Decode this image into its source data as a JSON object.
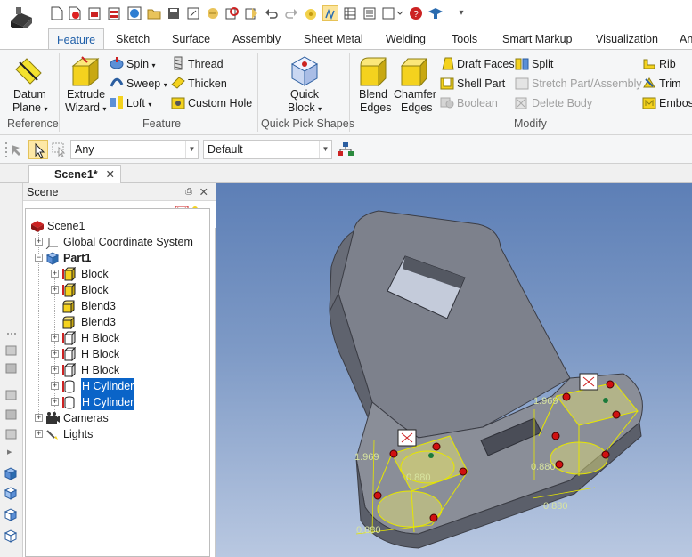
{
  "app": {
    "title": "IronCAD"
  },
  "quick_access": {
    "icons": [
      "new-icon",
      "new-template-icon",
      "open-red-icon",
      "print-icon",
      "globe-icon",
      "open-folder-icon",
      "save-icon",
      "save-as-icon",
      "publish-icon",
      "zoom-icon",
      "import-icon",
      "undo-icon",
      "redo-icon",
      "smart-icon",
      "catalog-icon",
      "table-icon",
      "list-icon",
      "help-icon",
      "graduate-icon",
      "customize-icon"
    ]
  },
  "tabs": [
    "Feature",
    "Sketch",
    "Surface",
    "Assembly",
    "Sheet Metal",
    "Welding",
    "Tools",
    "Smart Markup",
    "Visualization",
    "An"
  ],
  "ribbon": {
    "groups": [
      "Reference",
      "Feature",
      "Quick Pick Shapes",
      "Modify"
    ],
    "reference": {
      "datum_plane": "Datum",
      "datum_plane2": "Plane"
    },
    "feature": {
      "extrude": "Extrude",
      "extrude2": "Wizard",
      "spin": "Spin",
      "sweep": "Sweep",
      "loft": "Loft",
      "thread": "Thread",
      "thicken": "Thicken",
      "custom_hole": "Custom Hole"
    },
    "quick_pick": {
      "quick_block": "Quick",
      "quick_block2": "Block"
    },
    "modify": {
      "blend": "Blend",
      "blend2": "Edges",
      "chamfer": "Chamfer",
      "chamfer2": "Edges",
      "draft_faces": "Draft Faces",
      "shell_part": "Shell Part",
      "boolean": "Boolean",
      "split": "Split",
      "stretch": "Stretch Part/Assembly",
      "delete_body": "Delete Body",
      "rib": "Rib",
      "trim": "Trim",
      "emboss": "Embos"
    }
  },
  "command_bar": {
    "filter": "Any",
    "style": "Default"
  },
  "doc_tab": {
    "label": "Scene1*"
  },
  "scene_panel": {
    "title": "Scene",
    "tree": [
      {
        "label": "Scene1",
        "icon": "scene-icon"
      },
      {
        "label": "Global Coordinate System",
        "icon": "axes-icon"
      },
      {
        "label": "Part1",
        "icon": "part-icon"
      },
      {
        "label": "Block",
        "icon": "block-icon"
      },
      {
        "label": "Block",
        "icon": "block-icon"
      },
      {
        "label": "Blend3",
        "icon": "blend-icon"
      },
      {
        "label": "Blend3",
        "icon": "blend-icon"
      },
      {
        "label": "H Block",
        "icon": "hblock-icon"
      },
      {
        "label": "H Block",
        "icon": "hblock-icon"
      },
      {
        "label": "H Block",
        "icon": "hblock-icon"
      },
      {
        "label": "H Cylinder",
        "icon": "hcylinder-icon"
      },
      {
        "label": "H Cylinder",
        "icon": "hcylinder-icon"
      },
      {
        "label": "Cameras",
        "icon": "camera-icon"
      },
      {
        "label": "Lights",
        "icon": "light-icon"
      }
    ]
  },
  "viewport": {
    "dims": {
      "d1": "1.969",
      "d2": "1.969",
      "d3": "0.880",
      "d4": "0.880",
      "d5": "0.880",
      "d6": "0.880"
    }
  },
  "colors": {
    "accent": "#1f5fa8",
    "selection": "#0a64c8",
    "viewport_top": "#5d7fb6",
    "viewport_bottom": "#b9c8e1",
    "part": "#767a85",
    "selection_yellow": "#e6e600"
  }
}
